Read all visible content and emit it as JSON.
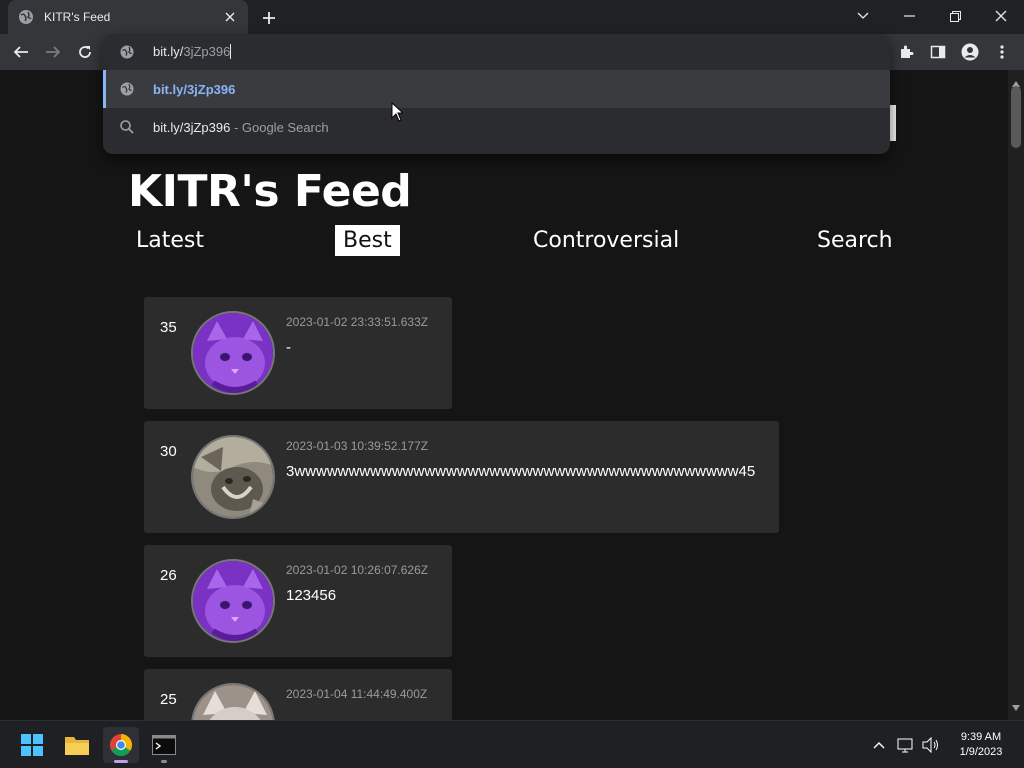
{
  "browser": {
    "tab": {
      "title": "KITR's Feed"
    },
    "omnibox": {
      "typed": "bit.ly/",
      "autocomplete": "3jZp396",
      "suggestions": [
        {
          "text": "bit.ly/3jZp396",
          "icon": "globe-icon"
        },
        {
          "text": "bit.ly/3jZp396",
          "suffix": " - Google Search",
          "icon": "search-icon"
        }
      ]
    }
  },
  "site": {
    "title": "KITR's Feed",
    "nav": [
      "Latest",
      "Best",
      "Controversial",
      "Search"
    ],
    "active_nav": "Best"
  },
  "posts": [
    {
      "score": "35",
      "timestamp": "2023-01-02 23:33:51.633Z",
      "text": "-",
      "avatar": "purple-cat"
    },
    {
      "score": "30",
      "timestamp": "2023-01-03 10:39:52.177Z",
      "text": "3wwwwwwwwwwwwwwwwwwwwwwwwwwwwwwwwwwwwwwwww45",
      "avatar": "grey-cat"
    },
    {
      "score": "26",
      "timestamp": "2023-01-02 10:26:07.626Z",
      "text": "123456",
      "avatar": "purple-cat"
    },
    {
      "score": "25",
      "timestamp": "2023-01-04 11:44:49.400Z",
      "text": "",
      "avatar": "tabby-cat"
    }
  ],
  "taskbar": {
    "apps": [
      "start-icon",
      "file-explorer-icon",
      "chrome-icon",
      "terminal-icon"
    ],
    "clock": {
      "time": "9:39 AM",
      "date": "1/9/2023"
    }
  },
  "colors": {
    "accent": "#8ab4f8",
    "page_bg": "#151515",
    "card_bg": "#2c2c2c",
    "avatar_purple": "#8a3fd1"
  }
}
